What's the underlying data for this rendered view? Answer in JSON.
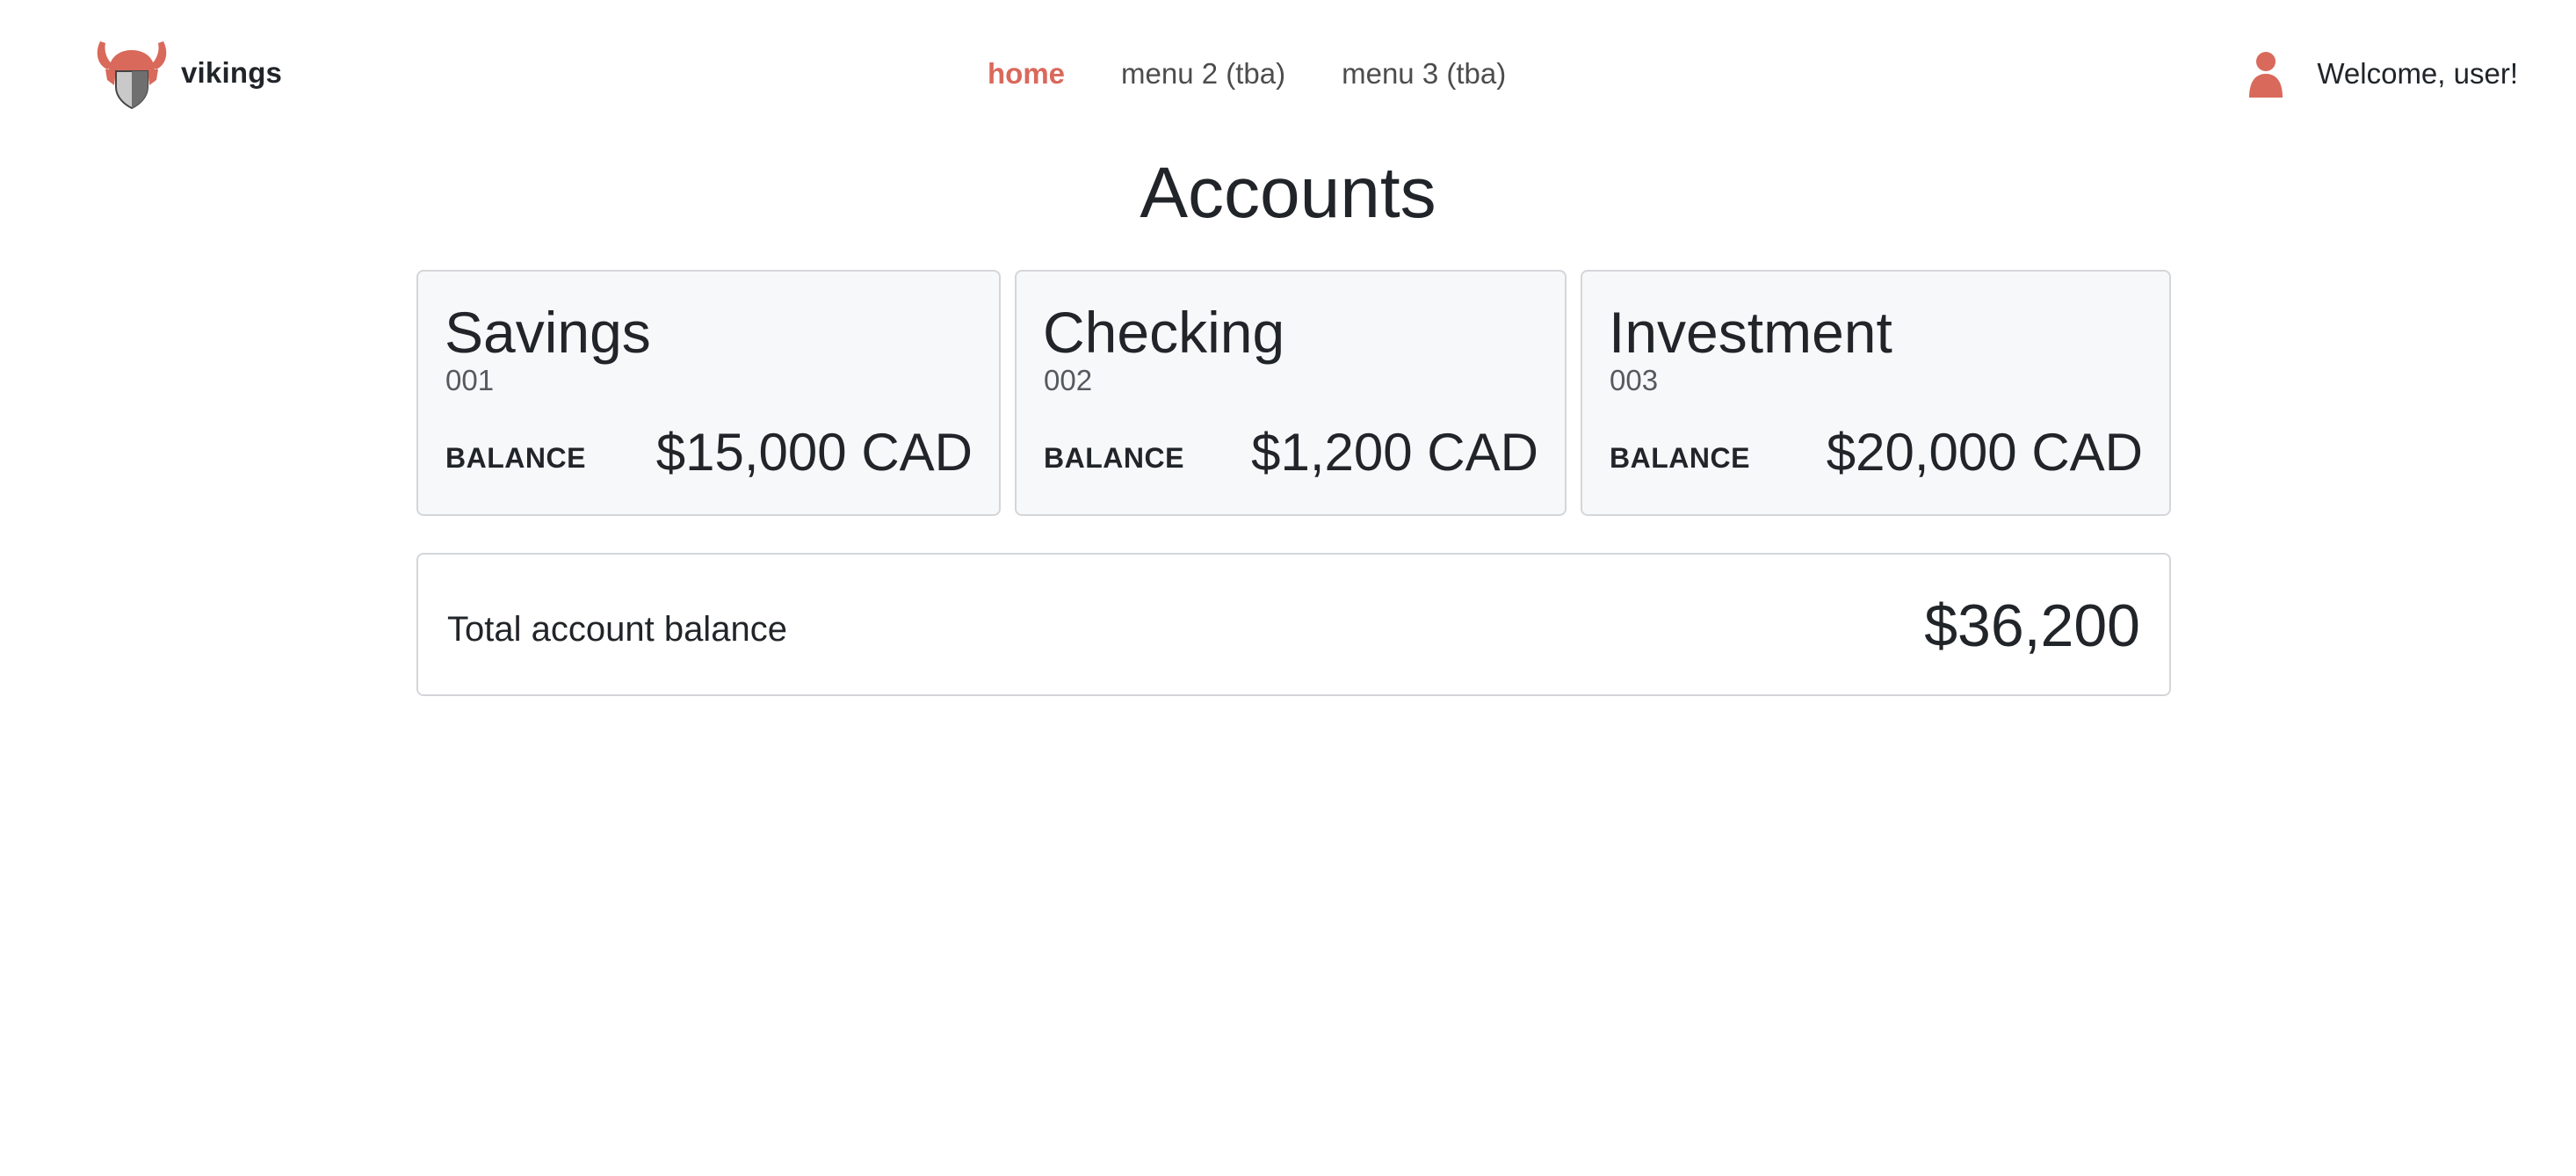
{
  "brand": {
    "name": "vikings",
    "logo_icon": "viking-helmet-shield-icon"
  },
  "nav": {
    "items": [
      {
        "label": "home",
        "active": true
      },
      {
        "label": "menu 2 (tba)",
        "active": false
      },
      {
        "label": "menu 3 (tba)",
        "active": false
      }
    ]
  },
  "user": {
    "icon": "user-icon",
    "welcome": "Welcome, user!"
  },
  "page": {
    "title": "Accounts"
  },
  "accounts": [
    {
      "name": "Savings",
      "number": "001",
      "balance_label": "BALANCE",
      "balance": "$15,000 CAD"
    },
    {
      "name": "Checking",
      "number": "002",
      "balance_label": "BALANCE",
      "balance": "$1,200 CAD"
    },
    {
      "name": "Investment",
      "number": "003",
      "balance_label": "BALANCE",
      "balance": "$20,000 CAD"
    }
  ],
  "total": {
    "label": "Total account balance",
    "value": "$36,200"
  },
  "colors": {
    "accent": "#d9695b",
    "text": "#212529",
    "muted": "#555a5f",
    "card_bg": "#f7f8fa",
    "border": "#d4d6d9",
    "shield_light": "#c9c9c9",
    "shield_dark": "#6f6f6f"
  }
}
